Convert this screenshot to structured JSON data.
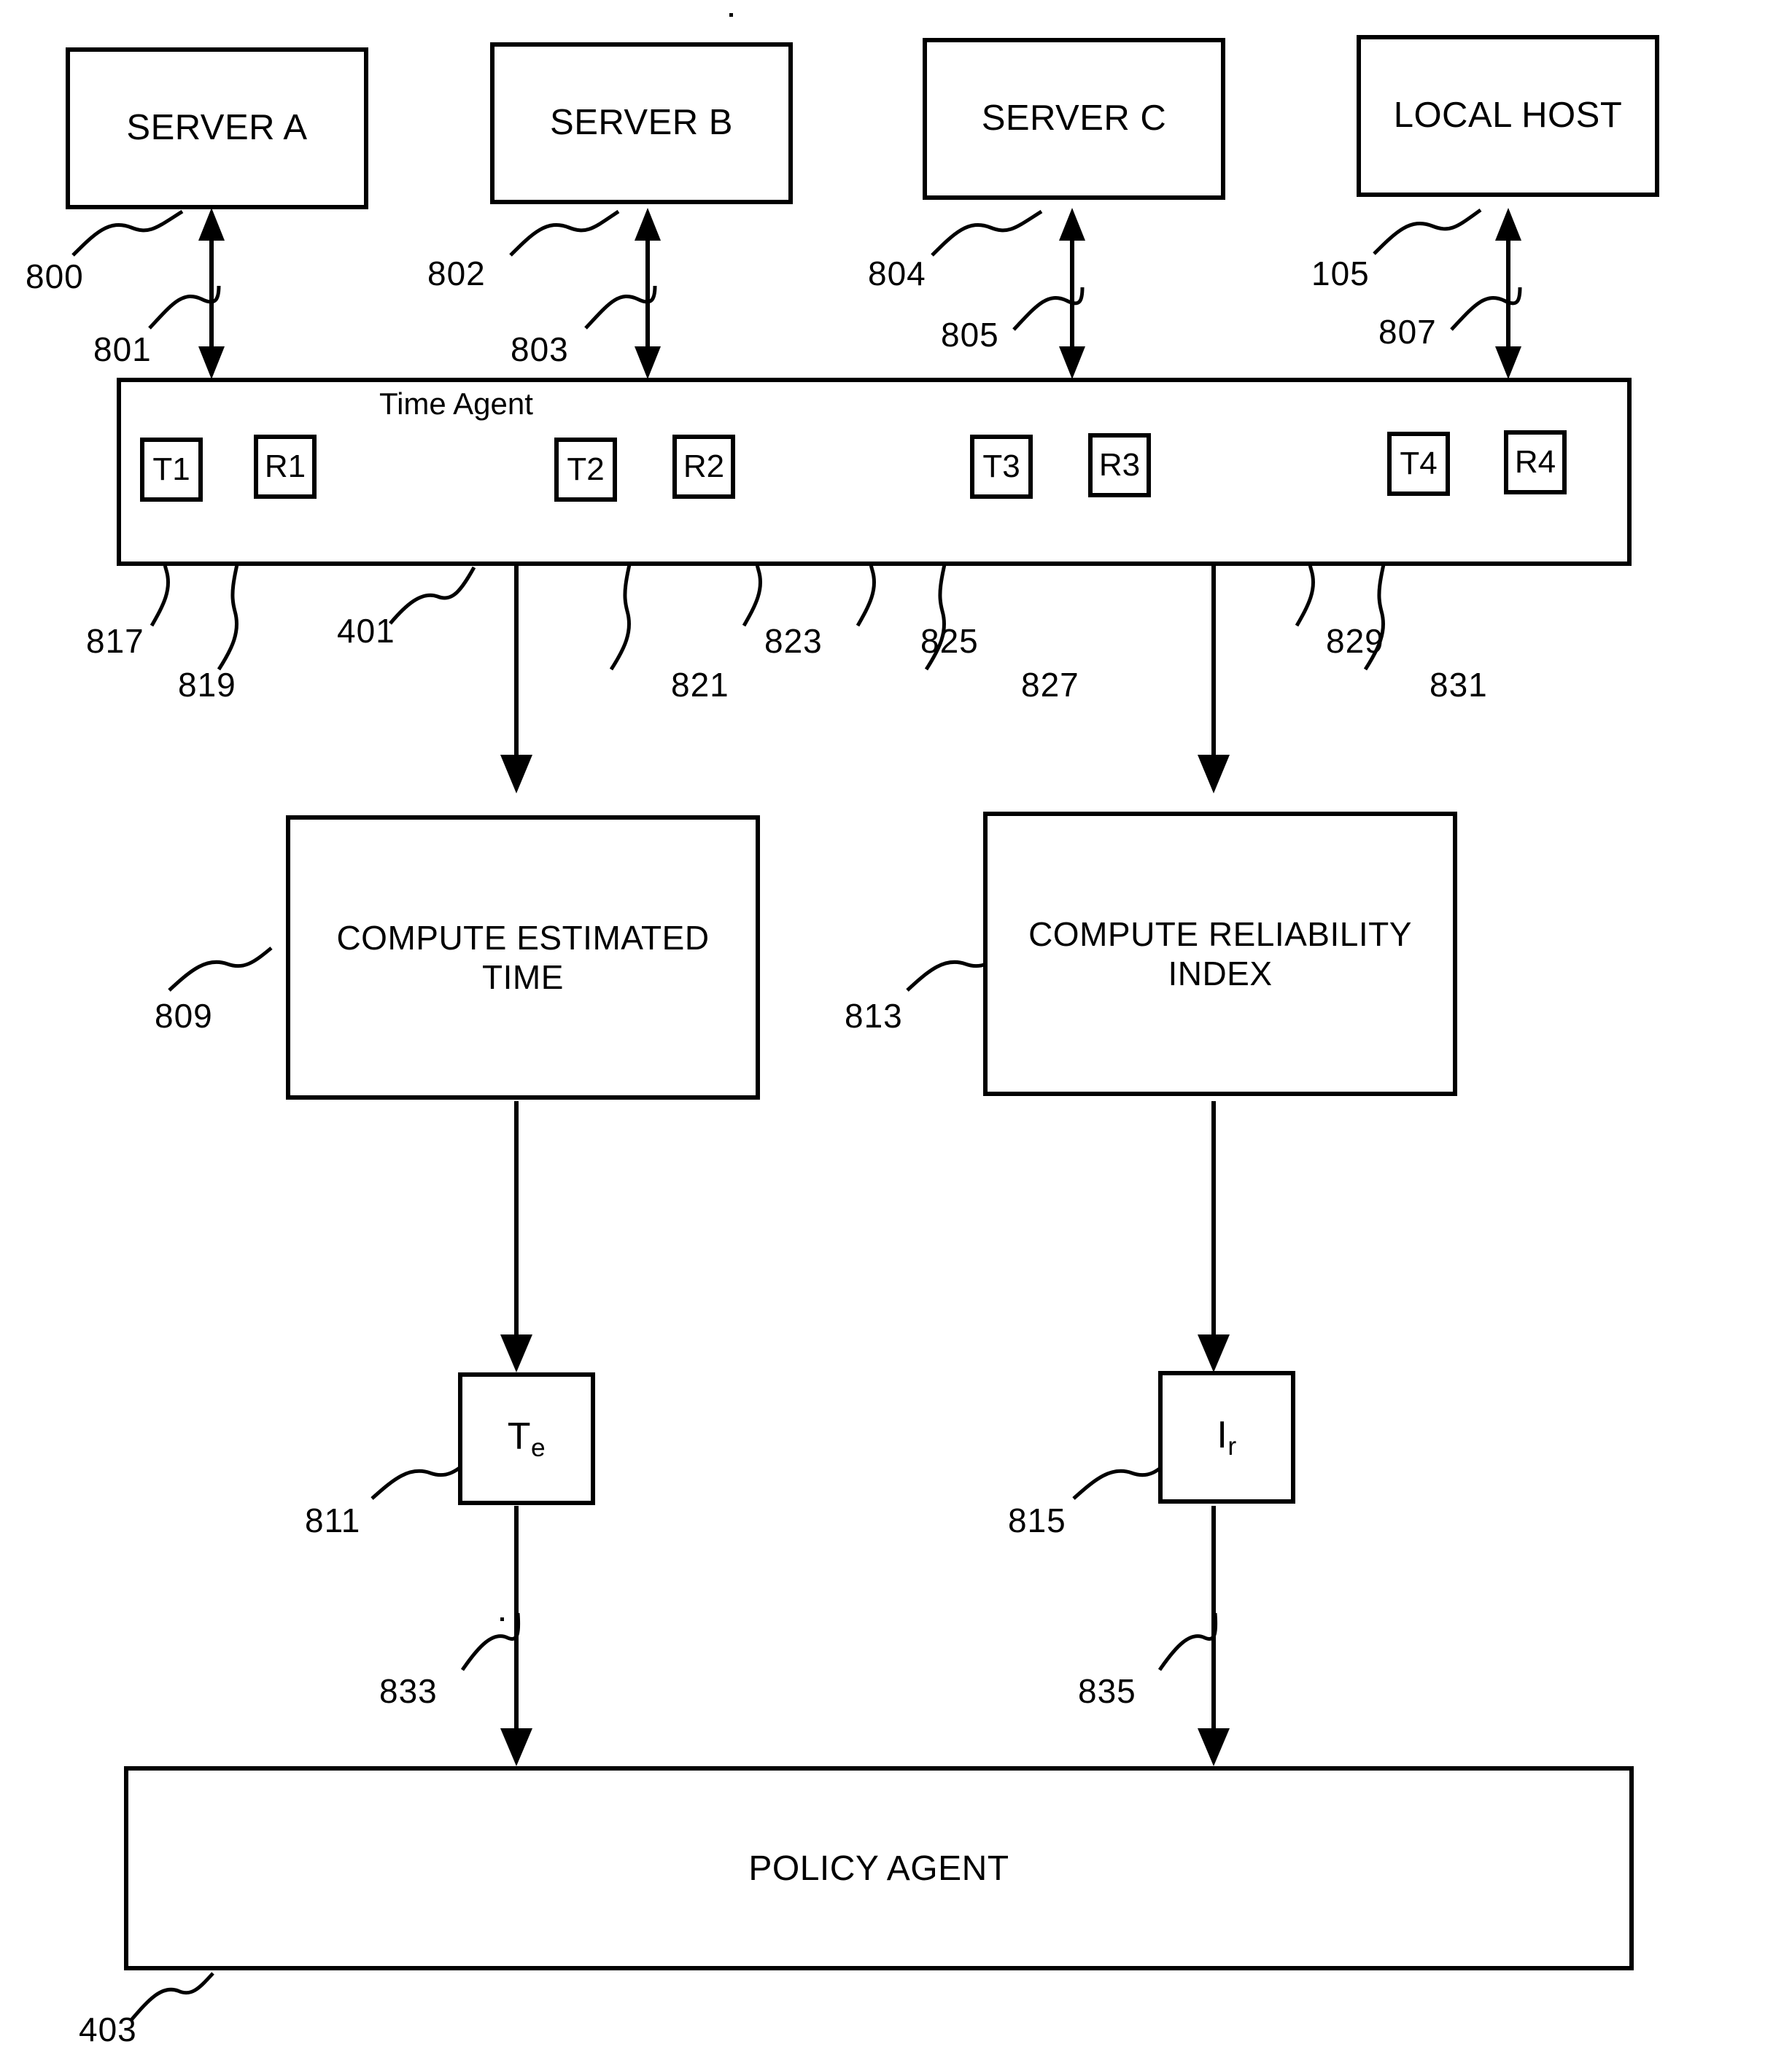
{
  "figure": {
    "title": "Time Agent and Policy Agent block diagram",
    "ink_color": "#000000",
    "background_color": "#ffffff"
  },
  "sources": [
    {
      "label": "SERVER A",
      "box_ref": "800",
      "link_ref": "801"
    },
    {
      "label": "SERVER B",
      "box_ref": "802",
      "link_ref": "803"
    },
    {
      "label": "SERVER C",
      "box_ref": "804",
      "link_ref": "805"
    },
    {
      "label": "LOCAL HOST",
      "box_ref": "105",
      "link_ref": "807"
    }
  ],
  "time_agent": {
    "title": "Time Agent",
    "ref": "401",
    "registers": [
      {
        "label": "T1",
        "ref": "817"
      },
      {
        "label": "R1",
        "ref": "819"
      },
      {
        "label": "T2",
        "ref": "821"
      },
      {
        "label": "R2",
        "ref": "823"
      },
      {
        "label": "T3",
        "ref": "825"
      },
      {
        "label": "R3",
        "ref": "827"
      },
      {
        "label": "T4",
        "ref": "829"
      },
      {
        "label": "R4",
        "ref": "831"
      }
    ]
  },
  "compute": {
    "estimated_time": {
      "line1": "COMPUTE ESTIMATED",
      "line2": "TIME",
      "ref": "809"
    },
    "reliability_index": {
      "line1": "COMPUTE RELIABILITY",
      "line2": "INDEX",
      "ref": "813"
    }
  },
  "outputs": [
    {
      "symbol": "T",
      "subscript": "e",
      "ref": "811",
      "flow_ref": "833"
    },
    {
      "symbol": "I",
      "subscript": "r",
      "ref": "815",
      "flow_ref": "835"
    }
  ],
  "policy_agent": {
    "label": "POLICY AGENT",
    "ref": "403"
  },
  "refs": {
    "r800": "800",
    "r801": "801",
    "r802": "802",
    "r803": "803",
    "r804": "804",
    "r805": "805",
    "r105": "105",
    "r807": "807",
    "r817": "817",
    "r819": "819",
    "r401": "401",
    "r821": "821",
    "r823": "823",
    "r825": "825",
    "r827": "827",
    "r829": "829",
    "r831": "831",
    "r809": "809",
    "r813": "813",
    "r811": "811",
    "r815": "815",
    "r833": "833",
    "r835": "835",
    "r403": "403"
  }
}
